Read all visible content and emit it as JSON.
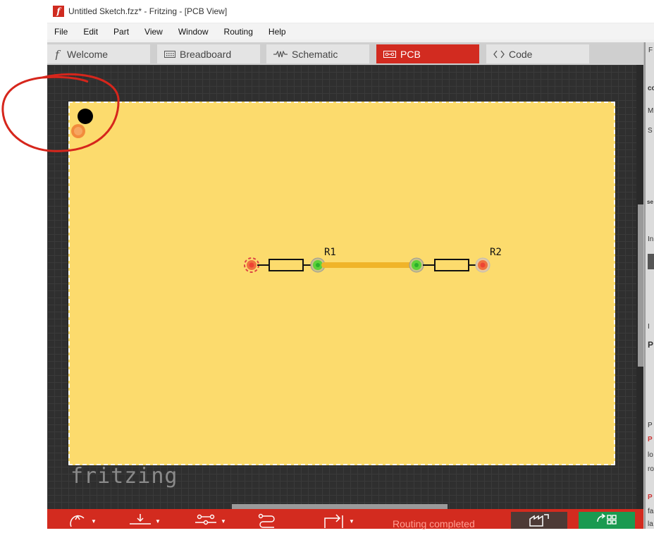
{
  "window": {
    "title": "Untitled Sketch.fzz* - Fritzing - [PCB View]",
    "app_icon": "f"
  },
  "menu": [
    "File",
    "Edit",
    "Part",
    "View",
    "Window",
    "Routing",
    "Help"
  ],
  "tabs": [
    {
      "label": "Welcome",
      "icon": "fritzing-f-icon",
      "active": false
    },
    {
      "label": "Breadboard",
      "icon": "breadboard-icon",
      "active": false
    },
    {
      "label": "Schematic",
      "icon": "resistor-symbol-icon",
      "active": false
    },
    {
      "label": "PCB",
      "icon": "pcb-icon",
      "active": true
    },
    {
      "label": "Code",
      "icon": "code-brackets-icon",
      "active": false
    }
  ],
  "pcb": {
    "board_color": "#fcdb6d",
    "trace_color": "#f0b429",
    "parts": [
      {
        "label": "R1"
      },
      {
        "label": "R2"
      }
    ],
    "watermark": "fritzing",
    "annotation": "red freehand circle around black and orange dots in top-left corner"
  },
  "toolbar": {
    "tools": [
      "rotate-icon",
      "autoroute-down-icon",
      "routing-tool-icon",
      "traces-icon",
      "share-icon"
    ],
    "status": "Routing completed",
    "dark_button_icon": "export-for-production-icon",
    "green_button_icon": "order-pcb-icon"
  },
  "dock_fragments": [
    "F",
    "C",
    "co",
    "M",
    "S",
    "se",
    "In",
    "I",
    "P",
    "P",
    "P",
    "lo",
    "ro",
    "P",
    "fa",
    "la"
  ],
  "colors": {
    "accent": "#d32b1f",
    "green": "#1a9a51",
    "canvas": "#2f2f2f"
  }
}
